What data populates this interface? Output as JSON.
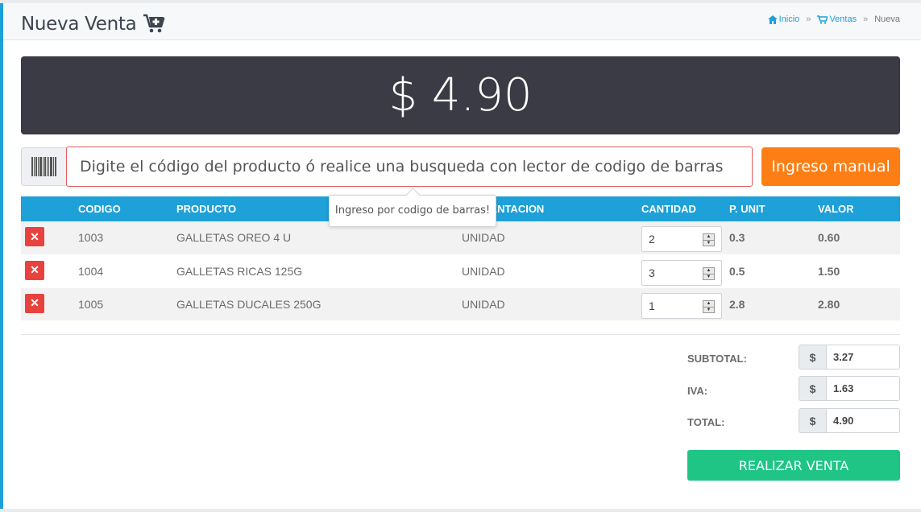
{
  "header": {
    "title": "Nueva Venta",
    "breadcrumb": {
      "home": "Inicio",
      "sales": "Ventas",
      "current": "Nueva",
      "separator": "»"
    }
  },
  "total_display": "$ 4.90",
  "search": {
    "placeholder": "Digite el código del producto ó realice una busqueda con lector de codigo de barras",
    "tooltip": "Ingreso por codigo de barras!"
  },
  "manual_button": "Ingreso manual",
  "table": {
    "columns": [
      "",
      "CODIGO",
      "PRODUCTO",
      "PRESENTACION",
      "CANTIDAD",
      "P. UNIT",
      "VALOR"
    ],
    "rows": [
      {
        "code": "1003",
        "product": "GALLETAS OREO 4 U",
        "presentation": "UNIDAD",
        "qty": "2",
        "unit_price": "0.3",
        "value": "0.60"
      },
      {
        "code": "1004",
        "product": "GALLETAS RICAS 125G",
        "presentation": "UNIDAD",
        "qty": "3",
        "unit_price": "0.5",
        "value": "1.50"
      },
      {
        "code": "1005",
        "product": "GALLETAS DUCALES 250G",
        "presentation": "UNIDAD",
        "qty": "1",
        "unit_price": "2.8",
        "value": "2.80"
      }
    ]
  },
  "summary": {
    "currency": "$",
    "subtotal_label": "SUBTOTAL:",
    "subtotal": "3.27",
    "iva_label": "IVA:",
    "iva": "1.63",
    "total_label": "TOTAL:",
    "total": "4.90"
  },
  "sale_button": "REALIZAR VENTA",
  "colors": {
    "accent": "#1ea0d8",
    "total_bg": "#3a3b44",
    "manual_btn": "#fd7e14",
    "delete_btn": "#e8423f",
    "sale_btn": "#1fc585"
  }
}
